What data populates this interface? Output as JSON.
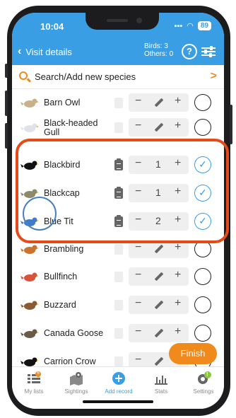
{
  "status_bar": {
    "time": "10:04",
    "battery": "89"
  },
  "header": {
    "back_label": "Visit details",
    "birds_count": "Birds: 3",
    "others_count": "Others: 0",
    "help_label": "?"
  },
  "search": {
    "label": "Search/Add new species",
    "arrow": ">"
  },
  "species": [
    {
      "name": "Barn Owl",
      "count": "",
      "checked": false,
      "has_notes": false,
      "color": "#c9b28a"
    },
    {
      "name": "Black-headed",
      "name2": "Gull",
      "count": "",
      "checked": false,
      "has_notes": false,
      "color": "#dfe3e8"
    },
    {
      "name": "Blackbird",
      "count": "1",
      "checked": true,
      "has_notes": true,
      "color": "#111111"
    },
    {
      "name": "Blackcap",
      "count": "1",
      "checked": true,
      "has_notes": true,
      "color": "#8d8a6a"
    },
    {
      "name": "Blue Tit",
      "count": "2",
      "checked": true,
      "has_notes": true,
      "color": "#3d7cc9"
    },
    {
      "name": "Brambling",
      "count": "",
      "checked": false,
      "has_notes": false,
      "color": "#c9732e"
    },
    {
      "name": "Bullfinch",
      "count": "",
      "checked": false,
      "has_notes": false,
      "color": "#d9533a"
    },
    {
      "name": "Buzzard",
      "count": "",
      "checked": false,
      "has_notes": false,
      "color": "#8a5a35"
    },
    {
      "name": "Canada Goose",
      "count": "",
      "checked": false,
      "has_notes": false,
      "color": "#6b5a45"
    },
    {
      "name": "Carrion Crow",
      "count": "",
      "checked": false,
      "has_notes": false,
      "color": "#111111"
    }
  ],
  "stepper": {
    "minus": "−",
    "plus": "+"
  },
  "check_mark": "✓",
  "finish_label": "Finish",
  "tabs": [
    {
      "label": "My lists",
      "badge": "6"
    },
    {
      "label": "Sightings"
    },
    {
      "label": "Add record"
    },
    {
      "label": "Stats"
    },
    {
      "label": "Settings",
      "badge": "!"
    }
  ],
  "colors": {
    "accent": "#3a9ee4",
    "orange": "#f08a1c",
    "highlight_red": "#e64a19",
    "highlight_blue": "#4a7fbf"
  }
}
